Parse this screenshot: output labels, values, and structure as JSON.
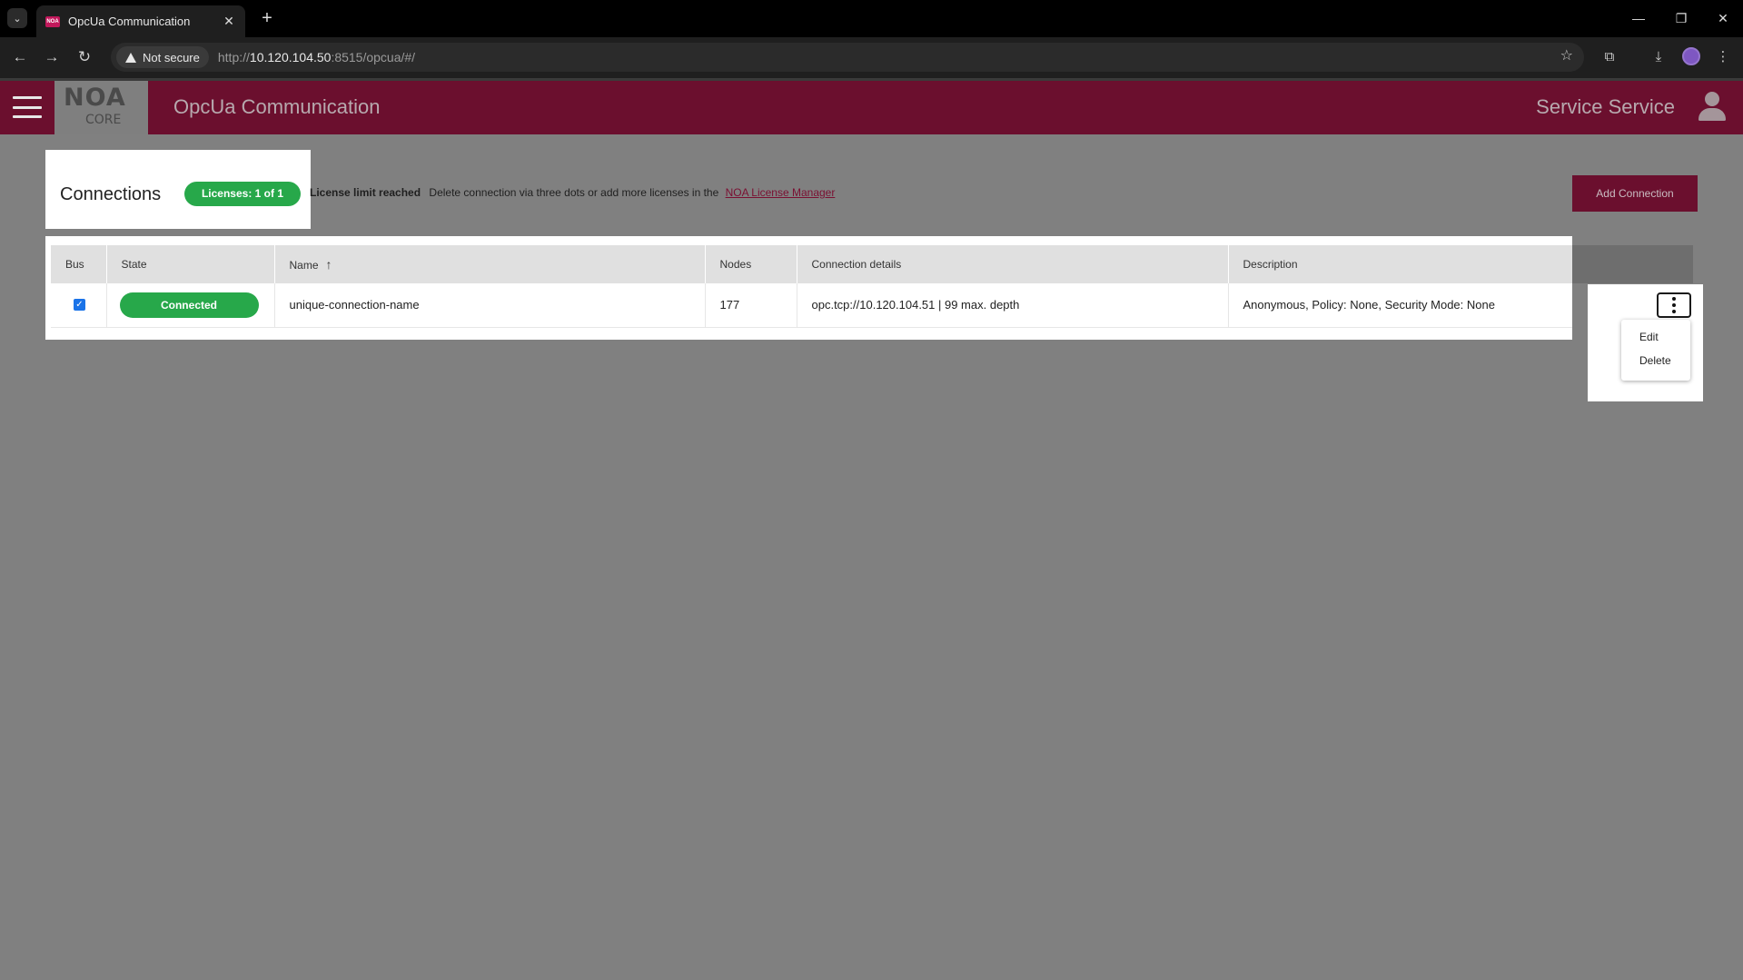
{
  "browser": {
    "tab_title": "OpcUa Communication",
    "tab_favicon_text": "NOA",
    "security_chip": "Not secure",
    "url_prefix": "http://",
    "url_host": "10.120.104.50",
    "url_rest": ":8515/opcua/#/"
  },
  "header": {
    "logo_text": "NOA",
    "logo_subtext": "CORE",
    "title": "OpcUa Communication",
    "user_name": "Service Service"
  },
  "connections": {
    "title": "Connections",
    "license_badge": "Licenses: 1 of 1",
    "limit_title": "License limit reached",
    "limit_message": "Delete connection via three dots or add more licenses in the",
    "license_link": "NOA License Manager",
    "add_button": "Add Connection"
  },
  "table": {
    "columns": [
      "Bus",
      "State",
      "Name",
      "Nodes",
      "Connection details",
      "Description"
    ],
    "sort_column": "Name",
    "sort_direction": "ascending",
    "rows": [
      {
        "bus_checked": true,
        "state": "Connected",
        "name": "unique-connection-name",
        "nodes": "177",
        "details": "opc.tcp://10.120.104.51 | 99 max. depth",
        "description": "Anonymous, Policy: None, Security Mode: None"
      }
    ]
  },
  "row_menu": {
    "items": [
      "Edit",
      "Delete"
    ]
  },
  "colors": {
    "brand": "#6b0f2e",
    "success": "#27a84a",
    "overlay": "#808080"
  }
}
